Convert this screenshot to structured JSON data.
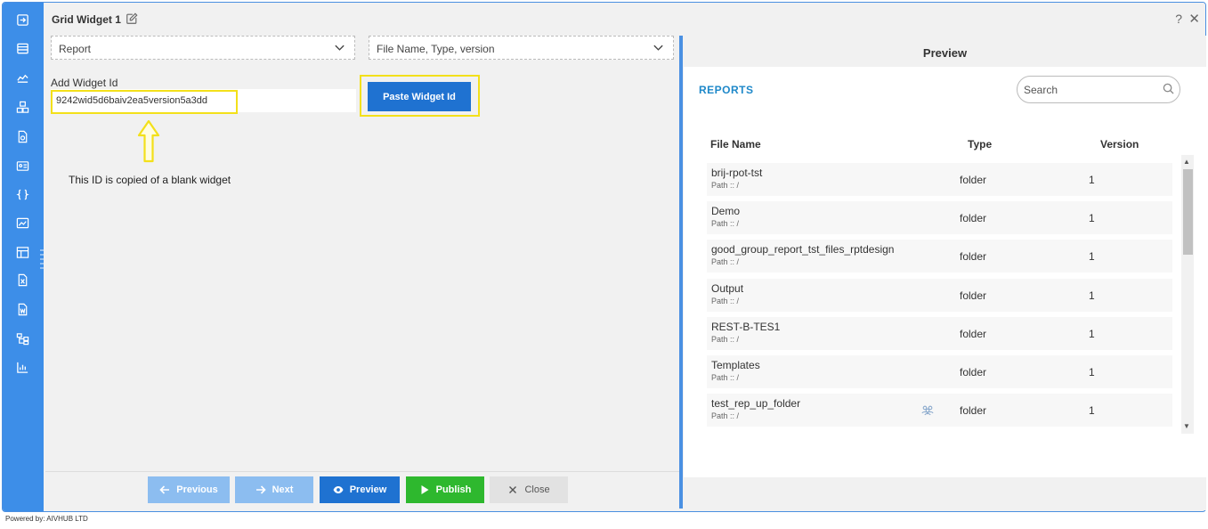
{
  "window": {
    "title": "Grid Widget 1",
    "help_glyph": "?",
    "close_glyph": "✕"
  },
  "rail": {
    "icons": [
      "sign-in-icon",
      "list-icon",
      "area-chart-icon",
      "cubes-icon",
      "report-file-icon",
      "id-card-icon",
      "code-braces-icon",
      "image-chart-icon",
      "table-icon",
      "excel-file-icon",
      "word-file-icon",
      "sitemap-icon",
      "bar-chart-icon"
    ]
  },
  "form": {
    "report_select": "Report",
    "columns_select": "File Name, Type, version",
    "widget_id_label": "Add Widget Id",
    "widget_id_value": "9242wid5d6baiv2ea5version5a3dd",
    "paste_button": "Paste Widget Id",
    "annotation": "This ID is copied of a blank widget",
    "annotation_color": "#f3e01a"
  },
  "footer": {
    "previous": "Previous",
    "next": "Next",
    "preview": "Preview",
    "publish": "Publish",
    "close": "Close"
  },
  "preview": {
    "title": "Preview",
    "section": "REPORTS",
    "search_placeholder": "Search",
    "columns": {
      "name": "File Name",
      "type": "Type",
      "version": "Version"
    },
    "rows": [
      {
        "name": "brij-rpot-tst",
        "path": "Path :: /",
        "type": "folder",
        "version": "1"
      },
      {
        "name": "Demo",
        "path": "Path :: /",
        "type": "folder",
        "version": "1"
      },
      {
        "name": "good_group_report_tst_files_rptdesign",
        "path": "Path :: /",
        "type": "folder",
        "version": "1"
      },
      {
        "name": "Output",
        "path": "Path :: /",
        "type": "folder",
        "version": "1"
      },
      {
        "name": "REST-B-TES1",
        "path": "Path :: /",
        "type": "folder",
        "version": "1"
      },
      {
        "name": "Templates",
        "path": "Path :: /",
        "type": "folder",
        "version": "1"
      },
      {
        "name": "test_rep_up_folder",
        "path": "Path :: /",
        "type": "folder",
        "version": "1",
        "shared": true
      }
    ]
  },
  "powered_by": "Powered by: AIVHUB LTD",
  "colors": {
    "accent": "#3d8ee8",
    "primary_button": "#1f72d1",
    "publish": "#2eb82e",
    "reports_label": "#1e88c9"
  }
}
